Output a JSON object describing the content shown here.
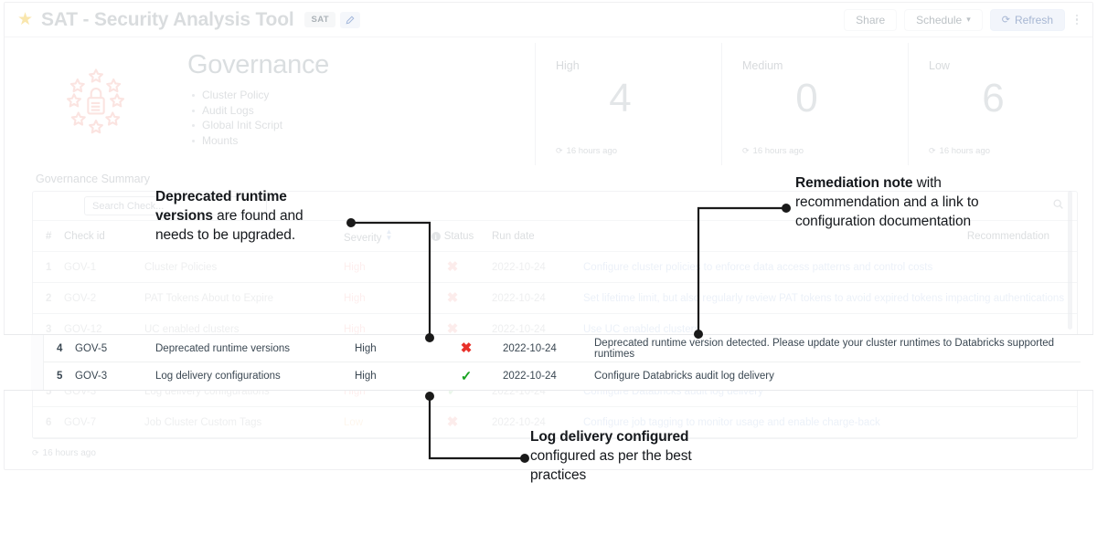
{
  "header": {
    "star_icon": "star-icon",
    "title": "SAT - Security Analysis Tool",
    "tag": "SAT",
    "edit_icon": "pencil-icon",
    "buttons": {
      "share": "Share",
      "schedule": "Schedule",
      "schedule_chevron": "chevron-down-icon",
      "refresh": "Refresh",
      "refresh_icon": "refresh-icon",
      "more_icon": "kebab-menu-icon"
    }
  },
  "hero": {
    "logo_icon": "gdpr-lock-stars-icon",
    "title": "Governance",
    "bullets": [
      "Cluster Policy",
      "Audit Logs",
      "Global Init Script",
      "Mounts"
    ]
  },
  "metrics": [
    {
      "label": "High",
      "value": "4",
      "updated": "16 hours ago"
    },
    {
      "label": "Medium",
      "value": "0",
      "updated": "16 hours ago"
    },
    {
      "label": "Low",
      "value": "6",
      "updated": "16 hours ago"
    }
  ],
  "table": {
    "title": "Governance Summary",
    "search_placeholder": "Search Check...",
    "search_icon": "search-icon",
    "columns": {
      "num": "#",
      "check_id": "Check id",
      "check_name": "",
      "severity": "Severity",
      "status": "Status",
      "run_date": "Run date",
      "recommendation": "Recommendation"
    },
    "status_info_icon": "info-icon",
    "severity_sort_icon": "sort-arrows-icon",
    "rows": [
      {
        "num": "1",
        "check_id": "GOV-1",
        "check_name": "Cluster Policies",
        "severity": "High",
        "status": "fail",
        "run_date": "2022-10-24",
        "recommendation": "Configure cluster policies to enforce data access patterns and control costs",
        "highlight": false
      },
      {
        "num": "2",
        "check_id": "GOV-2",
        "check_name": "PAT Tokens About to Expire",
        "severity": "High",
        "status": "fail",
        "run_date": "2022-10-24",
        "recommendation": "Set lifetime limit, but also regularly review PAT tokens to avoid expired tokens impacting authentications",
        "highlight": false
      },
      {
        "num": "3",
        "check_id": "GOV-12",
        "check_name": "UC enabled clusters",
        "severity": "High",
        "status": "fail",
        "run_date": "2022-10-24",
        "recommendation": "Use UC enabled clusters",
        "highlight": false
      },
      {
        "num": "4",
        "check_id": "GOV-5",
        "check_name": "Deprecated runtime versions",
        "severity": "High",
        "status": "fail",
        "run_date": "2022-10-24",
        "recommendation": "Deprecated runtime version detected. Please update your cluster runtimes to Databricks supported runtimes",
        "highlight": true
      },
      {
        "num": "5",
        "check_id": "GOV-3",
        "check_name": "Log delivery configurations",
        "severity": "High",
        "status": "pass",
        "run_date": "2022-10-24",
        "recommendation": "Configure Databricks audit log delivery",
        "highlight": true
      },
      {
        "num": "6",
        "check_id": "GOV-7",
        "check_name": "Job Cluster Custom Tags",
        "severity": "Low",
        "status": "fail",
        "run_date": "2022-10-24",
        "recommendation": "Configure job tagging to monitor usage and enable charge-back",
        "highlight": false
      }
    ],
    "footer_updated": "16 hours ago"
  },
  "annotations": [
    {
      "id": "deprecated-runtime",
      "bold": "Deprecated runtime versions",
      "rest": " are found and needs to be upgraded."
    },
    {
      "id": "remediation-note",
      "bold": "Remediation note",
      "rest": " with recommendation and a link to configuration documentation"
    },
    {
      "id": "log-delivery",
      "bold": "Log delivery configured",
      "rest": "  configured as per the best practices"
    }
  ],
  "status_glyphs": {
    "fail": "✖",
    "pass": "✓"
  },
  "colors": {
    "high": "#f0443e",
    "low": "#f0a23e",
    "fail": "#e8312a",
    "pass": "#18a321",
    "link": "#2563b5",
    "accent": "#e4ebf7",
    "star": "#f2c94c"
  }
}
